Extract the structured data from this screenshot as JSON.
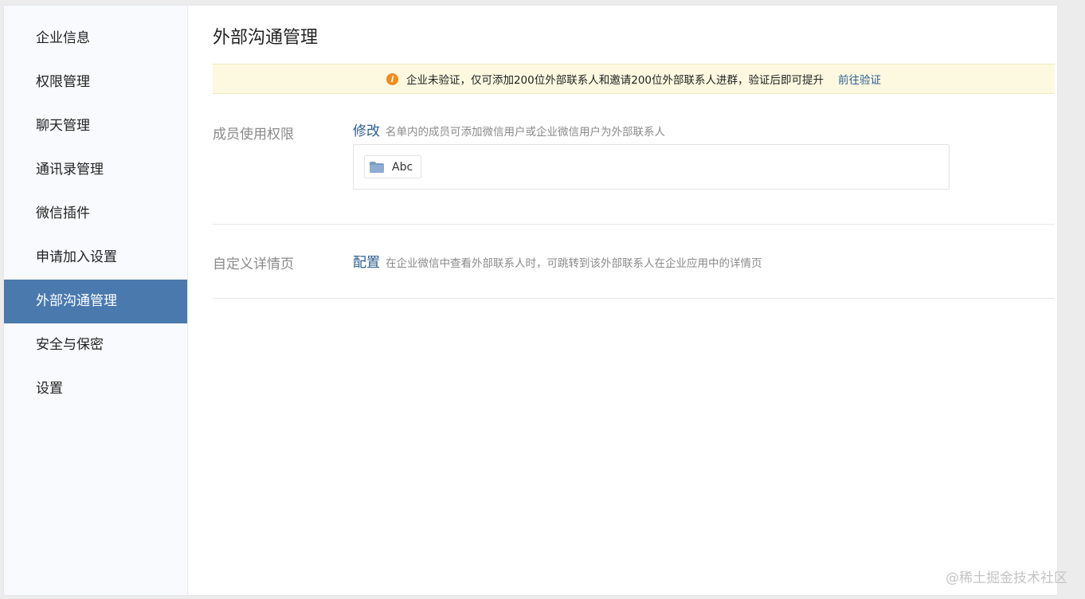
{
  "sidebar": {
    "items": [
      {
        "label": "企业信息"
      },
      {
        "label": "权限管理"
      },
      {
        "label": "聊天管理"
      },
      {
        "label": "通讯录管理"
      },
      {
        "label": "微信插件"
      },
      {
        "label": "申请加入设置"
      },
      {
        "label": "外部沟通管理",
        "active": true
      },
      {
        "label": "安全与保密"
      },
      {
        "label": "设置"
      }
    ]
  },
  "main": {
    "title": "外部沟通管理",
    "notice": {
      "text": "企业未验证，仅可添加200位外部联系人和邀请200位外部联系人进群，验证后即可提升",
      "link": "前往验证"
    },
    "member_permission": {
      "label": "成员使用权限",
      "action": "修改",
      "description": "名单内的成员可添加微信用户或企业微信用户为外部联系人",
      "members": [
        {
          "name": "Abc",
          "icon": "folder-icon"
        }
      ]
    },
    "custom_detail": {
      "label": "自定义详情页",
      "action": "配置",
      "description": "在企业微信中查看外部联系人时，可跳转到该外部联系人在企业应用中的详情页"
    }
  },
  "watermark": "@稀土掘金技术社区",
  "colors": {
    "accent": "#4a79ae",
    "link": "#2e5d8f",
    "notice_bg": "#fdf9e1",
    "warning": "#f28b19"
  }
}
